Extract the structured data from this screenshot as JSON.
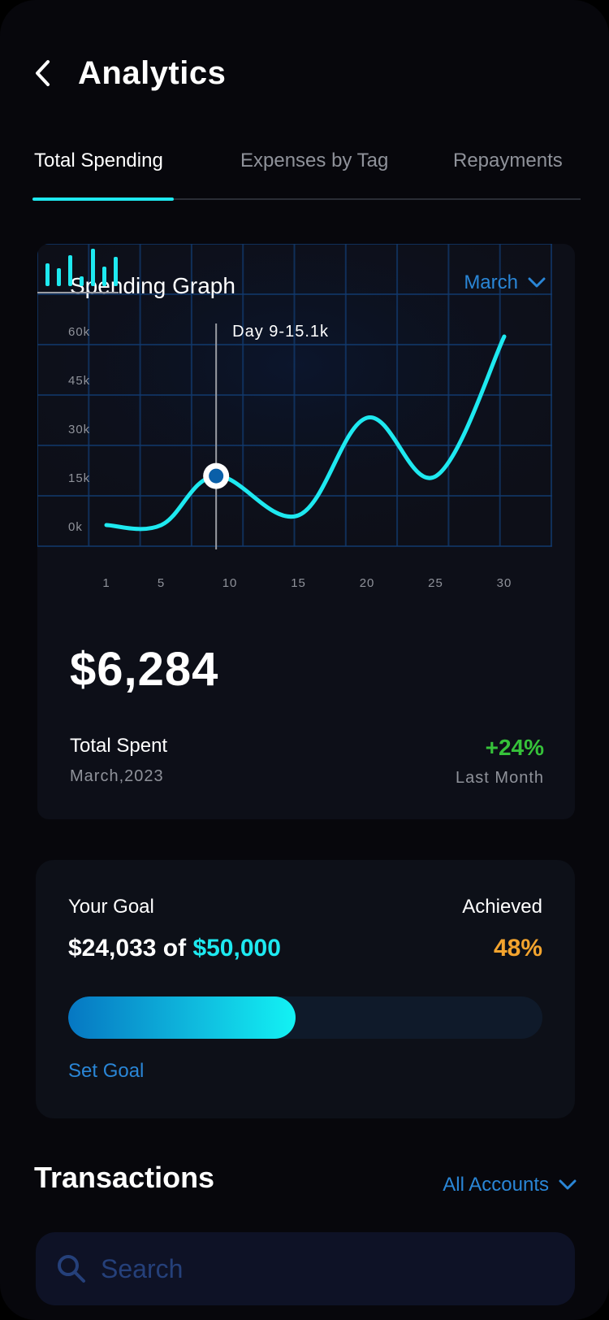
{
  "header": {
    "title": "Analytics",
    "back_icon": "chevron-left-icon"
  },
  "tabs": [
    {
      "label": "Total Spending",
      "active": true
    },
    {
      "label": "Expenses by Tag",
      "active": false
    },
    {
      "label": "Repayments",
      "active": false
    }
  ],
  "spending_card": {
    "title": "Spending Graph",
    "month_selector": "March",
    "total_amount": "$6,284",
    "total_label": "Total Spent",
    "total_date": "March,2023",
    "change": "+24%",
    "change_label": "Last Month"
  },
  "colors": {
    "accent": "#1ee9f0",
    "link": "#2a86d6",
    "positive": "#36c23a",
    "warning": "#f3a42e",
    "background": "#07070c"
  },
  "chart_data": {
    "type": "line",
    "x": [
      1,
      5,
      9,
      15,
      20,
      25,
      30
    ],
    "y": [
      0,
      0,
      15.1,
      3,
      33,
      15,
      58
    ],
    "xticks": [
      "1",
      "5",
      "10",
      "15",
      "20",
      "25",
      "30"
    ],
    "yticks": [
      "0k",
      "15k",
      "30k",
      "45k",
      "60k"
    ],
    "ylim": [
      0,
      60
    ],
    "xlim": [
      1,
      30
    ],
    "grid": true,
    "marker": {
      "x": 9,
      "y": 15.1,
      "label": "Day 9-15.1k"
    }
  },
  "goal": {
    "label": "Your Goal",
    "current": "$24,033 of ",
    "target": "$50,000",
    "achieved_label": "Achieved",
    "achieved_percent": "48%",
    "progress": 0.48,
    "set_goal_label": "Set Goal"
  },
  "transactions": {
    "title": "Transactions",
    "account_filter": "All Accounts",
    "search_placeholder": "Search"
  }
}
